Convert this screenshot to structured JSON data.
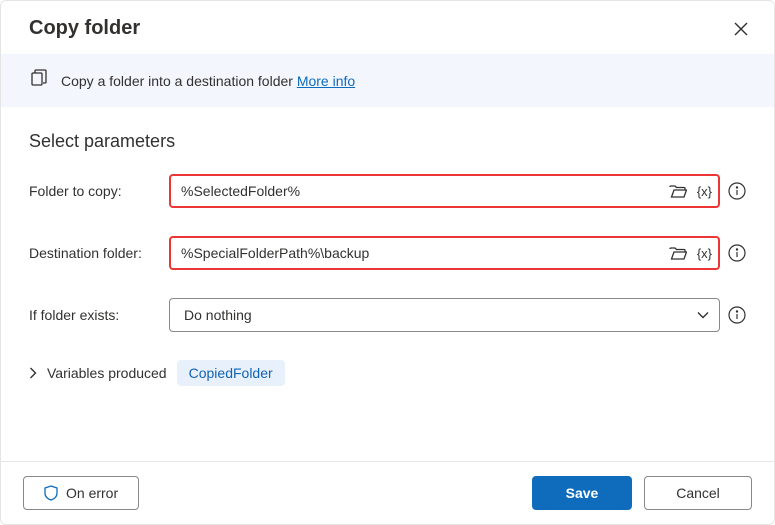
{
  "header": {
    "title": "Copy folder"
  },
  "banner": {
    "text": "Copy a folder into a destination folder ",
    "link": "More info"
  },
  "section_title": "Select parameters",
  "fields": {
    "folder_to_copy": {
      "label": "Folder to copy:",
      "value": "%SelectedFolder%"
    },
    "destination": {
      "label": "Destination folder:",
      "value": "%SpecialFolderPath%\\backup"
    },
    "if_exists": {
      "label": "If folder exists:",
      "selected": "Do nothing"
    }
  },
  "variables": {
    "label": "Variables produced",
    "chip": "CopiedFolder"
  },
  "footer": {
    "on_error": "On error",
    "save": "Save",
    "cancel": "Cancel"
  }
}
